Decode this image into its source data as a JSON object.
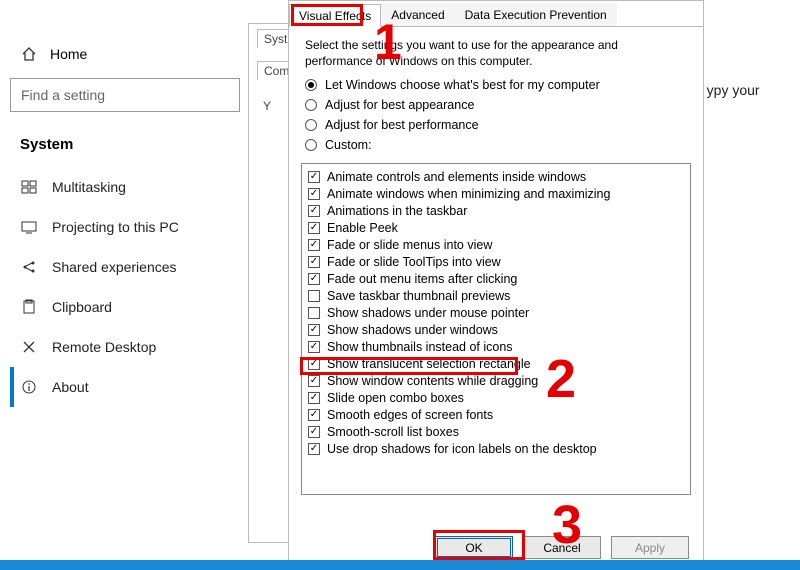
{
  "settings": {
    "home": "Home",
    "search_placeholder": "Find a setting",
    "section": "System",
    "nav": [
      {
        "icon": "multitasking-icon",
        "label": "Multitasking"
      },
      {
        "icon": "projecting-icon",
        "label": "Projecting to this PC"
      },
      {
        "icon": "shared-icon",
        "label": "Shared experiences"
      },
      {
        "icon": "clipboard-icon",
        "label": "Clipboard"
      },
      {
        "icon": "remote-icon",
        "label": "Remote Desktop"
      },
      {
        "icon": "about-icon",
        "label": "About"
      }
    ]
  },
  "sysprops": {
    "tab1_partial": "Syst",
    "tab2_partial": "Com",
    "text_partial": "Y"
  },
  "bg_text": "d ypy your",
  "perf": {
    "tabs": [
      "Visual Effects",
      "Advanced",
      "Data Execution Prevention"
    ],
    "active_tab": 0,
    "intro": "Select the settings you want to use for the appearance and performance of Windows on this computer.",
    "radios": [
      {
        "label": "Let Windows choose what's best for my computer",
        "selected": true
      },
      {
        "label": "Adjust for best appearance",
        "selected": false
      },
      {
        "label": "Adjust for best performance",
        "selected": false
      },
      {
        "label": "Custom:",
        "selected": false
      }
    ],
    "options": [
      {
        "label": "Animate controls and elements inside windows",
        "checked": true
      },
      {
        "label": "Animate windows when minimizing and maximizing",
        "checked": true
      },
      {
        "label": "Animations in the taskbar",
        "checked": true
      },
      {
        "label": "Enable Peek",
        "checked": true
      },
      {
        "label": "Fade or slide menus into view",
        "checked": true
      },
      {
        "label": "Fade or slide ToolTips into view",
        "checked": true
      },
      {
        "label": "Fade out menu items after clicking",
        "checked": true
      },
      {
        "label": "Save taskbar thumbnail previews",
        "checked": false
      },
      {
        "label": "Show shadows under mouse pointer",
        "checked": false
      },
      {
        "label": "Show shadows under windows",
        "checked": true
      },
      {
        "label": "Show thumbnails instead of icons",
        "checked": true
      },
      {
        "label": "Show translucent selection rectangle",
        "checked": true
      },
      {
        "label": "Show window contents while dragging",
        "checked": true
      },
      {
        "label": "Slide open combo boxes",
        "checked": true
      },
      {
        "label": "Smooth edges of screen fonts",
        "checked": true
      },
      {
        "label": "Smooth-scroll list boxes",
        "checked": true
      },
      {
        "label": "Use drop shadows for icon labels on the desktop",
        "checked": true
      }
    ],
    "buttons": {
      "ok": "OK",
      "cancel": "Cancel",
      "apply": "Apply"
    }
  },
  "annotations": {
    "n1": "1",
    "n2": "2",
    "n3": "3"
  }
}
